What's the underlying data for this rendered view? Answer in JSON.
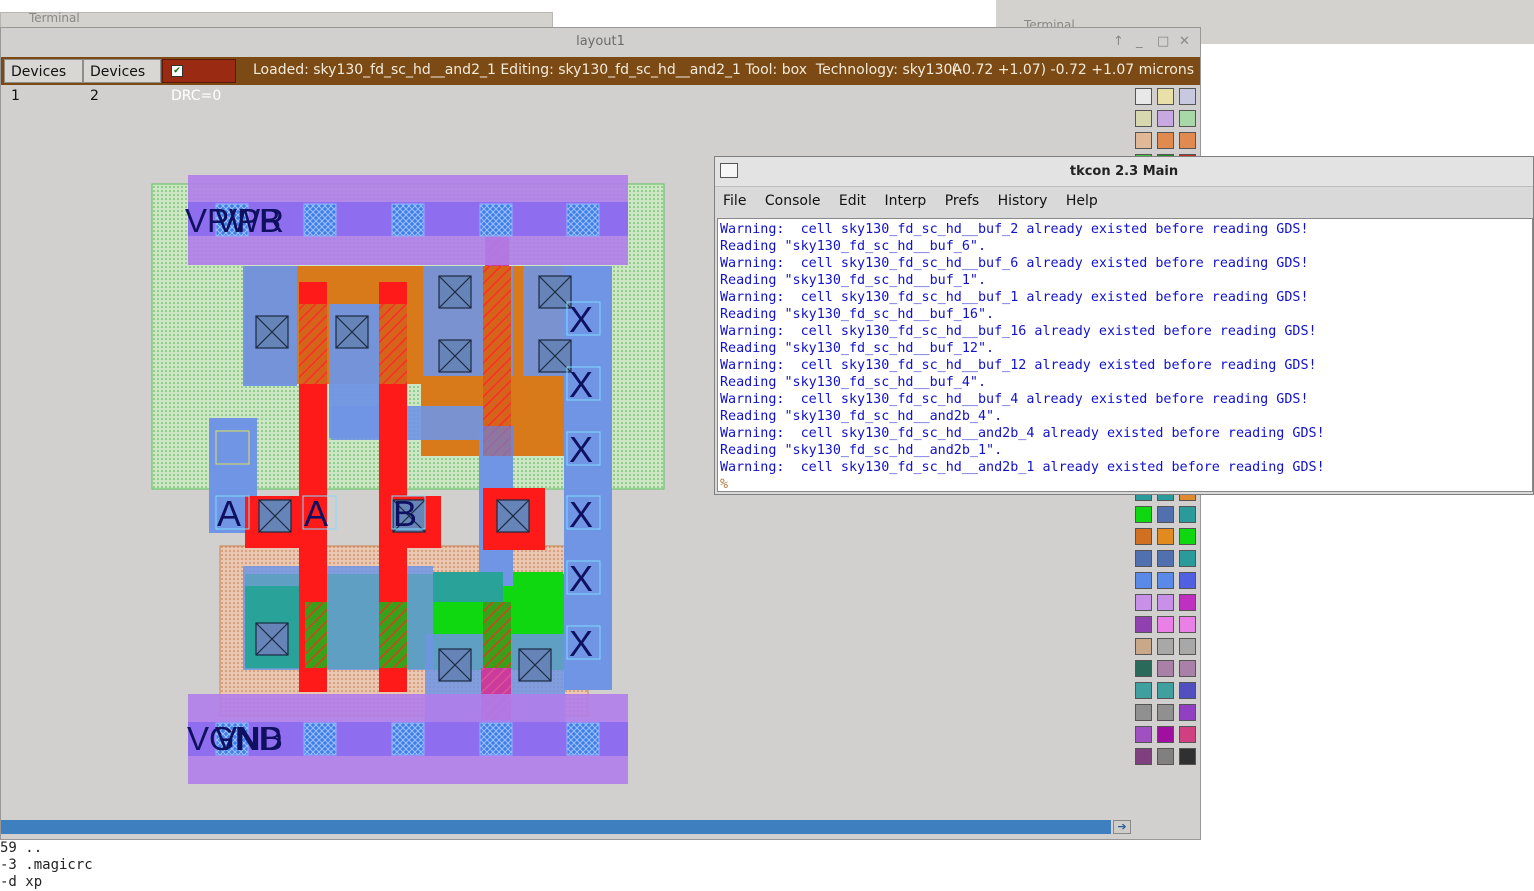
{
  "background": {
    "terminal_left_title": "Terminal",
    "terminal_right_title": "Terminal",
    "terminal_lines": [
      "59 ..",
      "-3 .magicrc",
      "-d xp"
    ]
  },
  "layout_window": {
    "title": "layout1",
    "buttons": [
      "↑",
      "_",
      "□",
      "✕"
    ],
    "toolbar": {
      "devices1": "Devices 1",
      "devices2": "Devices 2",
      "drc": "DRC=0",
      "status": "Loaded: sky130_fd_sc_hd__and2_1 Editing: sky130_fd_sc_hd__and2_1 Tool: box  Technology: sky130A",
      "coords": "(-0.72 +1.07) -0.72 +1.07 microns"
    },
    "labels": {
      "power_top": "VPWR",
      "power_top_overlay": "VPB",
      "ground_bottom": "VGND",
      "ground_bottom_overlay": "VNB",
      "pin_a": "A",
      "pin_b": "B",
      "pin_x": "X"
    },
    "colors": {
      "nwell": "#9fd79f",
      "metal1": "#b07dea",
      "li": "#6f95e4",
      "poly": "#ff1a1a",
      "ndiff": "#10d810",
      "pdiff": "#d97a1a",
      "toolbar_bg": "#7c4a14",
      "drc_bg": "#9a2b12"
    }
  },
  "tkcon": {
    "title": "tkcon 2.3 Main",
    "menu": [
      "File",
      "Console",
      "Edit",
      "Interp",
      "Prefs",
      "History",
      "Help"
    ],
    "lines": [
      "Warning:  cell sky130_fd_sc_hd__buf_2 already existed before reading GDS!",
      "Reading \"sky130_fd_sc_hd__buf_6\".",
      "Warning:  cell sky130_fd_sc_hd__buf_6 already existed before reading GDS!",
      "Reading \"sky130_fd_sc_hd__buf_1\".",
      "Warning:  cell sky130_fd_sc_hd__buf_1 already existed before reading GDS!",
      "Reading \"sky130_fd_sc_hd__buf_16\".",
      "Warning:  cell sky130_fd_sc_hd__buf_16 already existed before reading GDS!",
      "Reading \"sky130_fd_sc_hd__buf_12\".",
      "Warning:  cell sky130_fd_sc_hd__buf_12 already existed before reading GDS!",
      "Reading \"sky130_fd_sc_hd__buf_4\".",
      "Warning:  cell sky130_fd_sc_hd__buf_4 already existed before reading GDS!",
      "Reading \"sky130_fd_sc_hd__and2b_4\".",
      "Warning:  cell sky130_fd_sc_hd__and2b_4 already existed before reading GDS!",
      "Reading \"sky130_fd_sc_hd__and2b_1\".",
      "Warning:  cell sky130_fd_sc_hd__and2b_1 already existed before reading GDS!"
    ],
    "prompt": "%"
  }
}
